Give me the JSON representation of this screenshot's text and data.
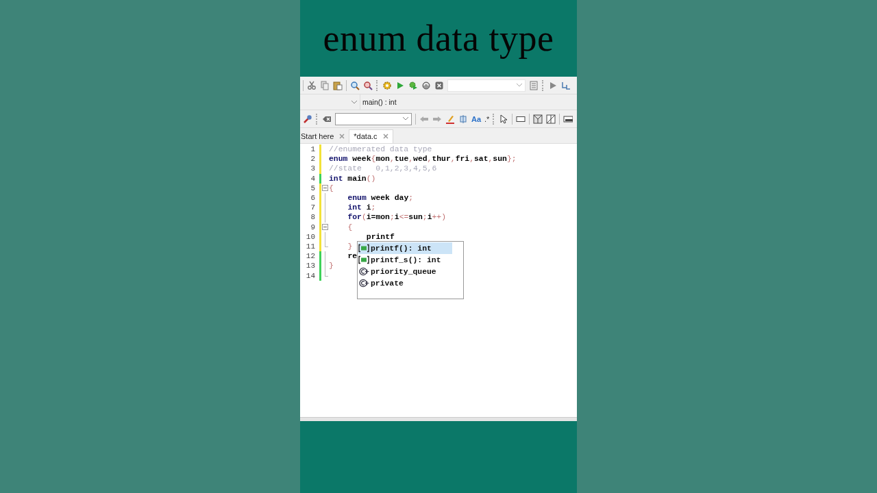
{
  "title": "enum data type",
  "toolbar": {
    "function_combo": "main() : int",
    "glyphs": [
      "Aa",
      ".*"
    ]
  },
  "tabs": [
    {
      "label": "Start here",
      "selected": false
    },
    {
      "label": "*data.c",
      "selected": true
    }
  ],
  "editor": {
    "lines": [
      {
        "number": "1",
        "modified": true,
        "fold_start": false,
        "in_fold": false,
        "fold_end": false,
        "tokens": [
          {
            "kind": "comment",
            "text": "//enumerated data type"
          }
        ]
      },
      {
        "number": "2",
        "modified": true,
        "fold_start": false,
        "in_fold": false,
        "fold_end": false,
        "tokens": [
          {
            "kind": "keyword",
            "text": "enum "
          },
          {
            "kind": "ident",
            "text": "week"
          },
          {
            "kind": "punct",
            "text": "{"
          },
          {
            "kind": "ident",
            "text": "mon"
          },
          {
            "kind": "punct",
            "text": ","
          },
          {
            "kind": "ident",
            "text": "tue"
          },
          {
            "kind": "punct",
            "text": ","
          },
          {
            "kind": "ident",
            "text": "wed"
          },
          {
            "kind": "punct",
            "text": ","
          },
          {
            "kind": "ident",
            "text": "thur"
          },
          {
            "kind": "punct",
            "text": ","
          },
          {
            "kind": "ident",
            "text": "fri"
          },
          {
            "kind": "punct",
            "text": ","
          },
          {
            "kind": "ident",
            "text": "sat"
          },
          {
            "kind": "punct",
            "text": ","
          },
          {
            "kind": "ident",
            "text": "sun"
          },
          {
            "kind": "punct",
            "text": "};"
          }
        ]
      },
      {
        "number": "3",
        "modified": true,
        "fold_start": false,
        "in_fold": false,
        "fold_end": false,
        "tokens": [
          {
            "kind": "comment",
            "text": "//state   0,1,2,3,4,5,6"
          }
        ]
      },
      {
        "number": "4",
        "modified": false,
        "fold_start": false,
        "in_fold": false,
        "fold_end": false,
        "tokens": [
          {
            "kind": "keyword",
            "text": "int "
          },
          {
            "kind": "ident",
            "text": "main"
          },
          {
            "kind": "punct",
            "text": "()"
          }
        ]
      },
      {
        "number": "5",
        "modified": true,
        "fold_start": true,
        "in_fold": false,
        "fold_end": false,
        "tokens": [
          {
            "kind": "punct",
            "text": "{"
          }
        ]
      },
      {
        "number": "6",
        "modified": true,
        "fold_start": false,
        "in_fold": true,
        "fold_end": false,
        "tokens": [
          {
            "kind": "keyword",
            "text": "    enum "
          },
          {
            "kind": "ident",
            "text": "week day"
          },
          {
            "kind": "punct",
            "text": ";"
          }
        ]
      },
      {
        "number": "7",
        "modified": true,
        "fold_start": false,
        "in_fold": true,
        "fold_end": false,
        "tokens": [
          {
            "kind": "keyword",
            "text": "    int "
          },
          {
            "kind": "ident",
            "text": "i"
          },
          {
            "kind": "punct",
            "text": ";"
          }
        ]
      },
      {
        "number": "8",
        "modified": true,
        "fold_start": false,
        "in_fold": true,
        "fold_end": false,
        "tokens": [
          {
            "kind": "keyword",
            "text": "    for"
          },
          {
            "kind": "punct",
            "text": "("
          },
          {
            "kind": "ident",
            "text": "i=mon"
          },
          {
            "kind": "punct",
            "text": ";"
          },
          {
            "kind": "ident",
            "text": "i"
          },
          {
            "kind": "punct",
            "text": "<="
          },
          {
            "kind": "ident",
            "text": "sun"
          },
          {
            "kind": "punct",
            "text": ";"
          },
          {
            "kind": "ident",
            "text": "i"
          },
          {
            "kind": "punct",
            "text": "++)"
          }
        ]
      },
      {
        "number": "9",
        "modified": true,
        "fold_start": true,
        "in_fold": false,
        "fold_end": false,
        "tokens": [
          {
            "kind": "punct",
            "text": "    {"
          }
        ]
      },
      {
        "number": "10",
        "modified": true,
        "fold_start": false,
        "in_fold": true,
        "fold_end": false,
        "tokens": [
          {
            "kind": "ident",
            "text": "        printf"
          }
        ]
      },
      {
        "number": "11",
        "modified": true,
        "fold_start": false,
        "in_fold": false,
        "fold_end": true,
        "tokens": [
          {
            "kind": "punct",
            "text": "    }"
          }
        ]
      },
      {
        "number": "12",
        "modified": false,
        "fold_start": false,
        "in_fold": true,
        "fold_end": false,
        "tokens": [
          {
            "kind": "ident",
            "text": "    re"
          }
        ]
      },
      {
        "number": "13",
        "modified": false,
        "fold_start": false,
        "in_fold": true,
        "fold_end": false,
        "tokens": [
          {
            "kind": "punct",
            "text": "}"
          }
        ]
      },
      {
        "number": "14",
        "modified": false,
        "fold_start": false,
        "in_fold": false,
        "fold_end": true
      }
    ],
    "autocomplete": [
      {
        "label": "printf(): int",
        "kind": "function",
        "selected": true
      },
      {
        "label": "printf_s(): int",
        "kind": "function",
        "selected": false
      },
      {
        "label": "priority_queue",
        "kind": "class",
        "selected": false
      },
      {
        "label": "private",
        "kind": "class",
        "selected": false
      }
    ]
  }
}
